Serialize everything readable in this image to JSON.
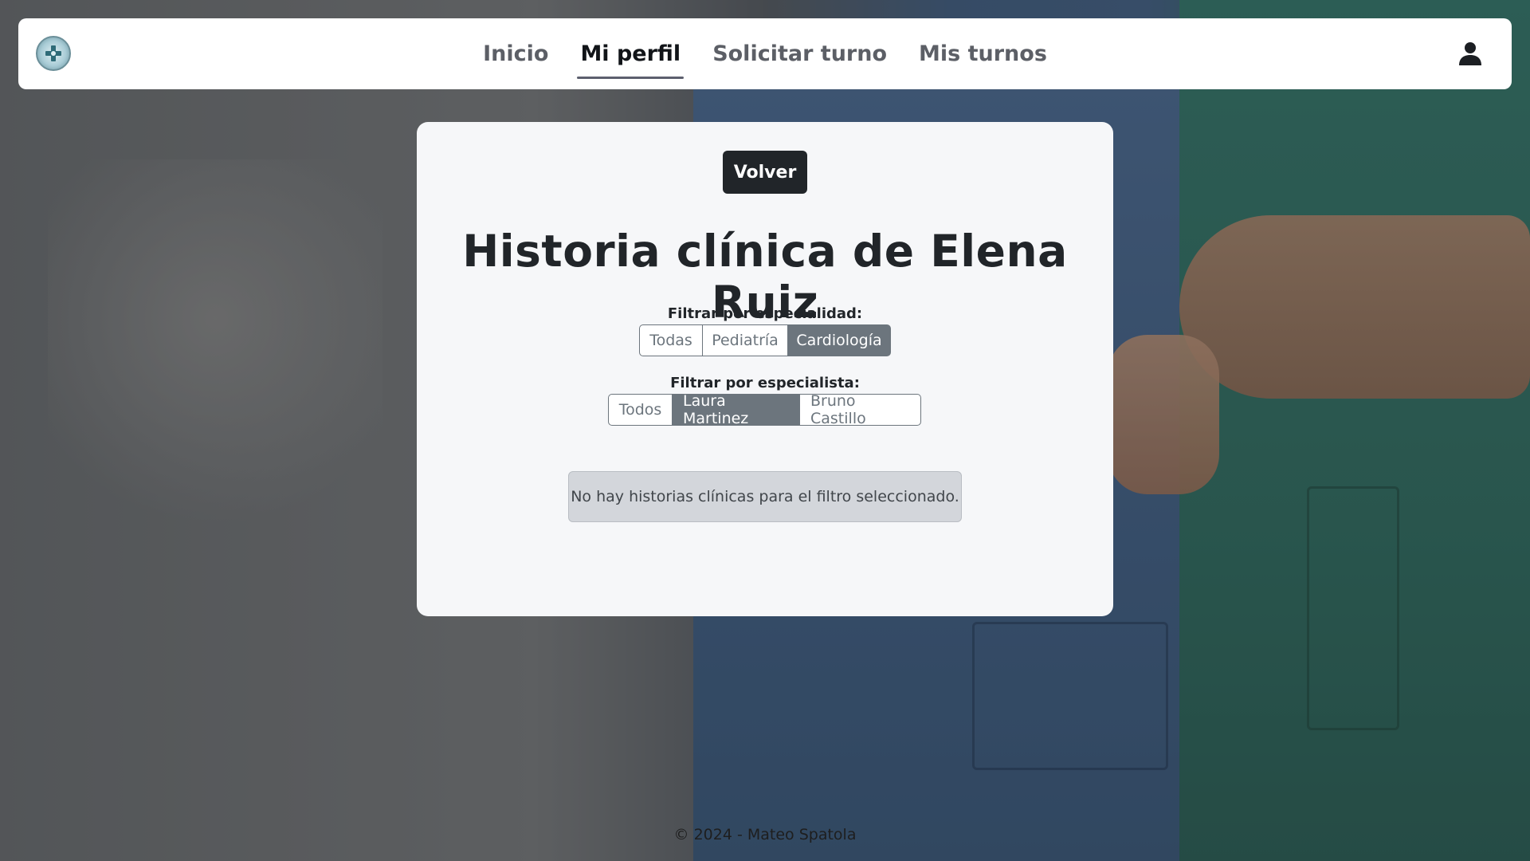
{
  "nav": {
    "links": [
      {
        "label": "Inicio"
      },
      {
        "label": "Mi perfil",
        "active": true
      },
      {
        "label": "Solicitar turno"
      },
      {
        "label": "Mis turnos"
      }
    ],
    "logo_icon": "clinic-logo-icon",
    "user_icon": "user-icon"
  },
  "card": {
    "back_label": "Volver",
    "title": "Historia clínica de Elena Ruiz",
    "specialty_filter": {
      "label": "Filtrar por especialidad:",
      "options": [
        "Todas",
        "Pediatría",
        "Cardiología"
      ],
      "selected": "Cardiología"
    },
    "specialist_filter": {
      "label": "Filtrar por especialista:",
      "options": [
        "Todos",
        "Laura Martinez",
        "Bruno Castillo"
      ],
      "selected": "Laura Martinez"
    },
    "empty_message": "No hay historias clínicas para el filtro seleccionado."
  },
  "footer": {
    "text": "© 2024 - Mateo Spatola"
  },
  "colors": {
    "primary_dark": "#212529",
    "secondary": "#6c757d",
    "card_bg": "#f6f7f9"
  }
}
